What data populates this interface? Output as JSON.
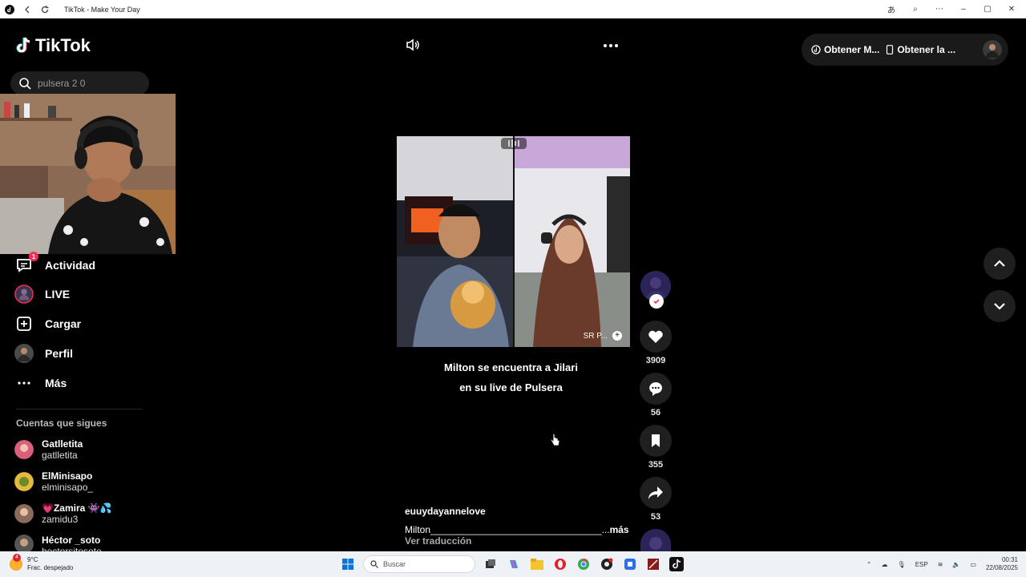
{
  "browser": {
    "title": "TikTok - Make Your Day"
  },
  "sidebar": {
    "logo": "TikTok",
    "search": {
      "value": "pulsera 2 0"
    },
    "nav": [
      {
        "label": "Actividad",
        "icon": "inbox-icon",
        "badge": "1"
      },
      {
        "label": "LIVE",
        "icon": "live-icon"
      },
      {
        "label": "Cargar",
        "icon": "plus-square-icon"
      },
      {
        "label": "Perfil",
        "icon": "avatar"
      },
      {
        "label": "Más",
        "icon": "ellipsis-icon"
      }
    ],
    "following_title": "Cuentas que sigues",
    "following": [
      {
        "name": "Gatlletita",
        "handle": "gatlletita"
      },
      {
        "name": "ElMinisapo",
        "handle": "elminisapo_"
      },
      {
        "name": "💗Zamira 👾💦",
        "handle": "zamidu3"
      },
      {
        "name": "Héctor _soto",
        "handle": "hectorsitosoto"
      }
    ]
  },
  "topbar": {
    "btn1": "Obtener M...",
    "btn2": "Obtener la ..."
  },
  "video": {
    "caption_line1": "Milton se encuentra a Jilari",
    "caption_line2": "en su live de Pulsera",
    "overlay_tag": "SR P...",
    "author": "euuydayannelove",
    "description": "Milton________________________________...",
    "more": "más",
    "translate": "Ver traducción"
  },
  "actions": {
    "likes": "3909",
    "comments": "56",
    "saves": "355",
    "shares": "53"
  },
  "taskbar": {
    "temp": "9°C",
    "weather": "Frac. despejado",
    "weather_badge": "4",
    "search": "Buscar",
    "lang": "ESP",
    "time": "00:31",
    "date": "22/08/2025"
  },
  "colors": {
    "accent": "#fe2c55",
    "background": "#000000"
  }
}
